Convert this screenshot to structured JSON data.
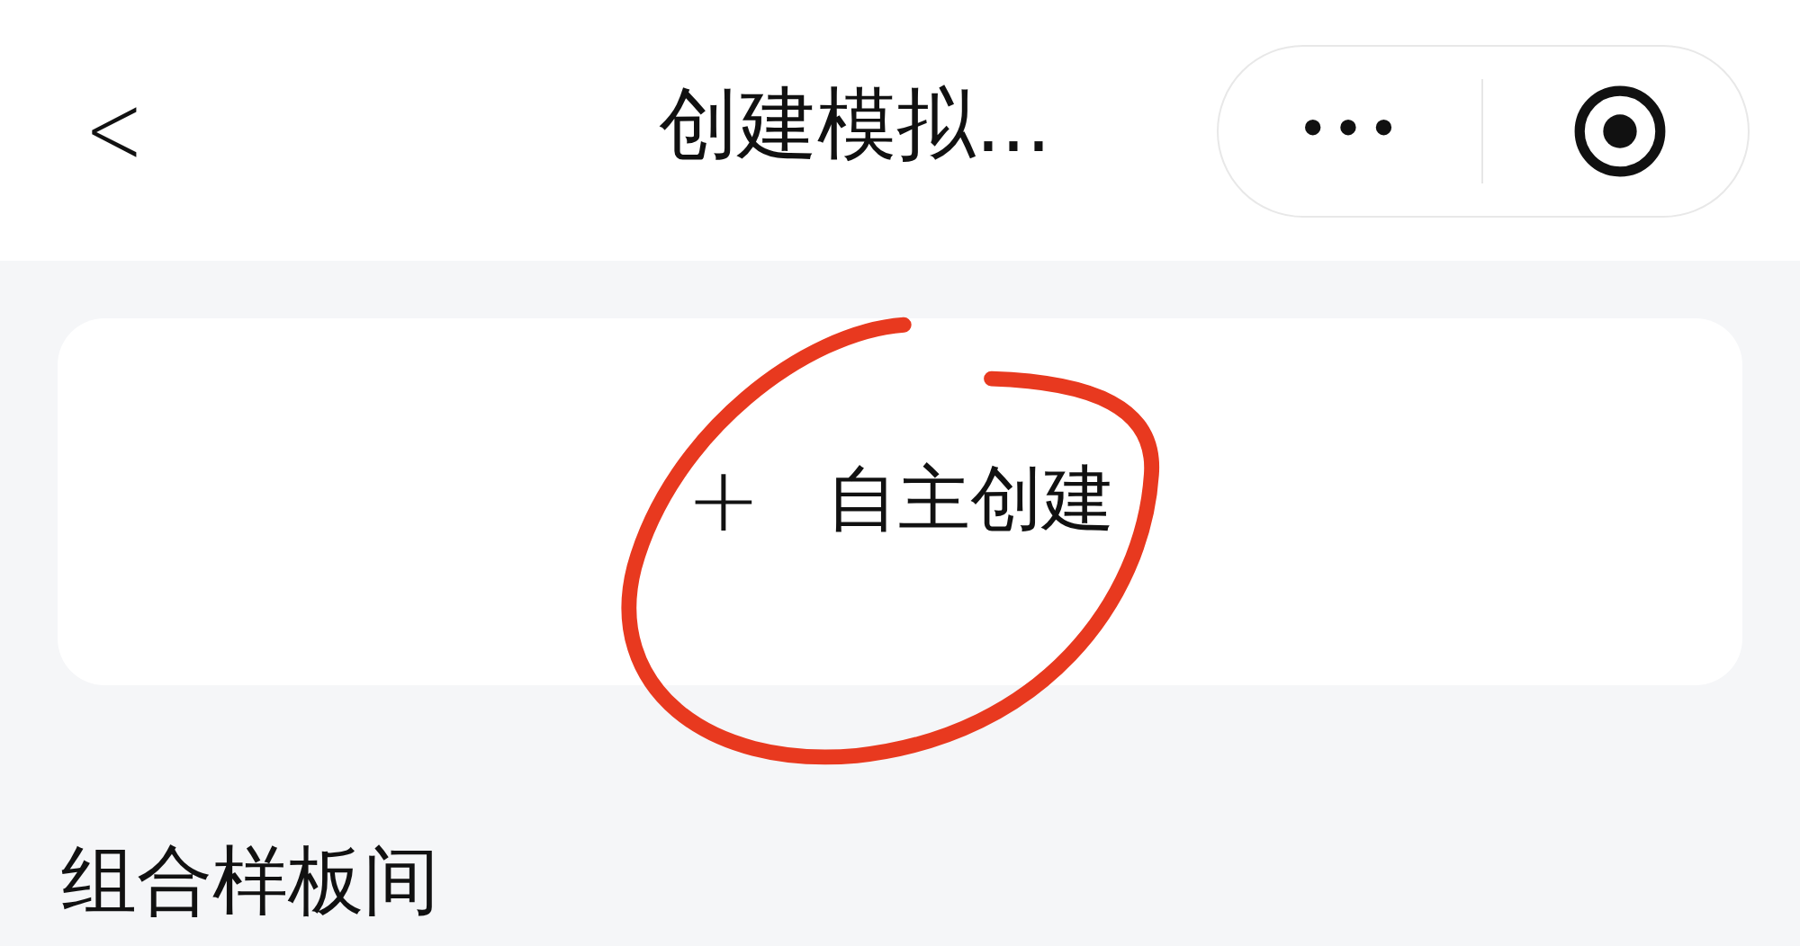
{
  "nav_bar": {
    "back": "<",
    "title": "创建模拟...",
    "capsule": {
      "more": "•••"
    }
  },
  "create_card": {
    "icon": "+",
    "label": "自主创建",
    "highlighted": true
  },
  "section_title": "组合样板间"
}
